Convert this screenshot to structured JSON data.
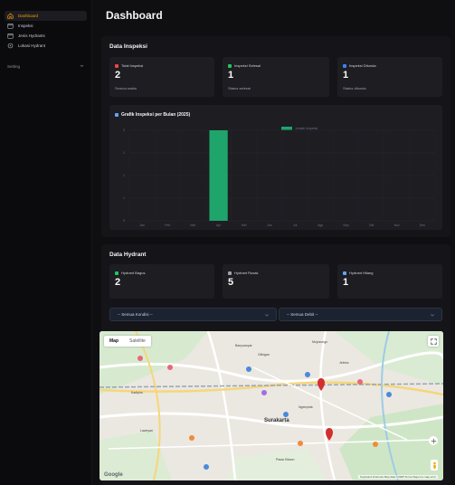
{
  "sidebar": {
    "items": [
      {
        "label": "Dashboard",
        "icon": "home-icon",
        "active": true
      },
      {
        "label": "Inspeksi",
        "icon": "calendar-icon",
        "active": false
      },
      {
        "label": "Jenis Hydrants",
        "icon": "calendar-icon",
        "active": false
      },
      {
        "label": "Lokasi Hydrant",
        "icon": "pin-icon",
        "active": false
      }
    ],
    "setting_label": "Setting"
  },
  "page": {
    "title": "Dashboard"
  },
  "inspeksi": {
    "title": "Data Inspeksi",
    "cards": [
      {
        "label": "Total Inspeksi",
        "value": "2",
        "sub": "Semua waktu",
        "color": "#ef4444"
      },
      {
        "label": "Inspeksi Selesai",
        "value": "1",
        "sub": "Status selesai",
        "color": "#22c55e"
      },
      {
        "label": "Inspeksi Ditunda",
        "value": "1",
        "sub": "Status ditunda",
        "color": "#3b82f6"
      }
    ]
  },
  "chart": {
    "title": "Grafik Inspeksi per Bulan (2025)"
  },
  "chart_data": {
    "type": "bar",
    "title": "Grafik Inspeksi per Bulan (2025)",
    "categories": [
      "Jan",
      "Feb",
      "Mar",
      "Apr",
      "Mei",
      "Jun",
      "Jul",
      "Agu",
      "Sep",
      "Okt",
      "Nov",
      "Des"
    ],
    "series": [
      {
        "name": "Jumlah Inspeksi",
        "values": [
          0,
          0,
          0,
          2,
          0,
          0,
          0,
          0,
          0,
          0,
          0,
          0
        ],
        "color": "#1fa56b"
      }
    ],
    "ylim": [
      0,
      2
    ],
    "yticks": [
      "2",
      "1",
      "1",
      "1",
      "0"
    ],
    "grid": true,
    "legend": "top"
  },
  "hydrant": {
    "title": "Data Hydrant",
    "cards": [
      {
        "label": "Hydrant Bagus",
        "value": "2",
        "color": "#22c55e"
      },
      {
        "label": "Hydrant Rusak",
        "value": "5",
        "color": "#9ca3af"
      },
      {
        "label": "Hydrant Hilang",
        "value": "1",
        "color": "#60a5fa"
      }
    ]
  },
  "filters": {
    "kondisi": "-- Semua Kondisi --",
    "debit": "-- Semua Debit --"
  },
  "map": {
    "tab_map": "Map",
    "tab_satellite": "Satellite",
    "city_label": "Surakarta",
    "labels": [
      "Kadipiro",
      "Banyuanyar",
      "Jebres",
      "Pasar Kliwon",
      "Laweyan",
      "Ngemplak",
      "Gilingan",
      "Mojosongo"
    ],
    "google": "Google",
    "attribution": "Keyboard shortcuts  Map data ©2025  Terms  Report a map error"
  }
}
